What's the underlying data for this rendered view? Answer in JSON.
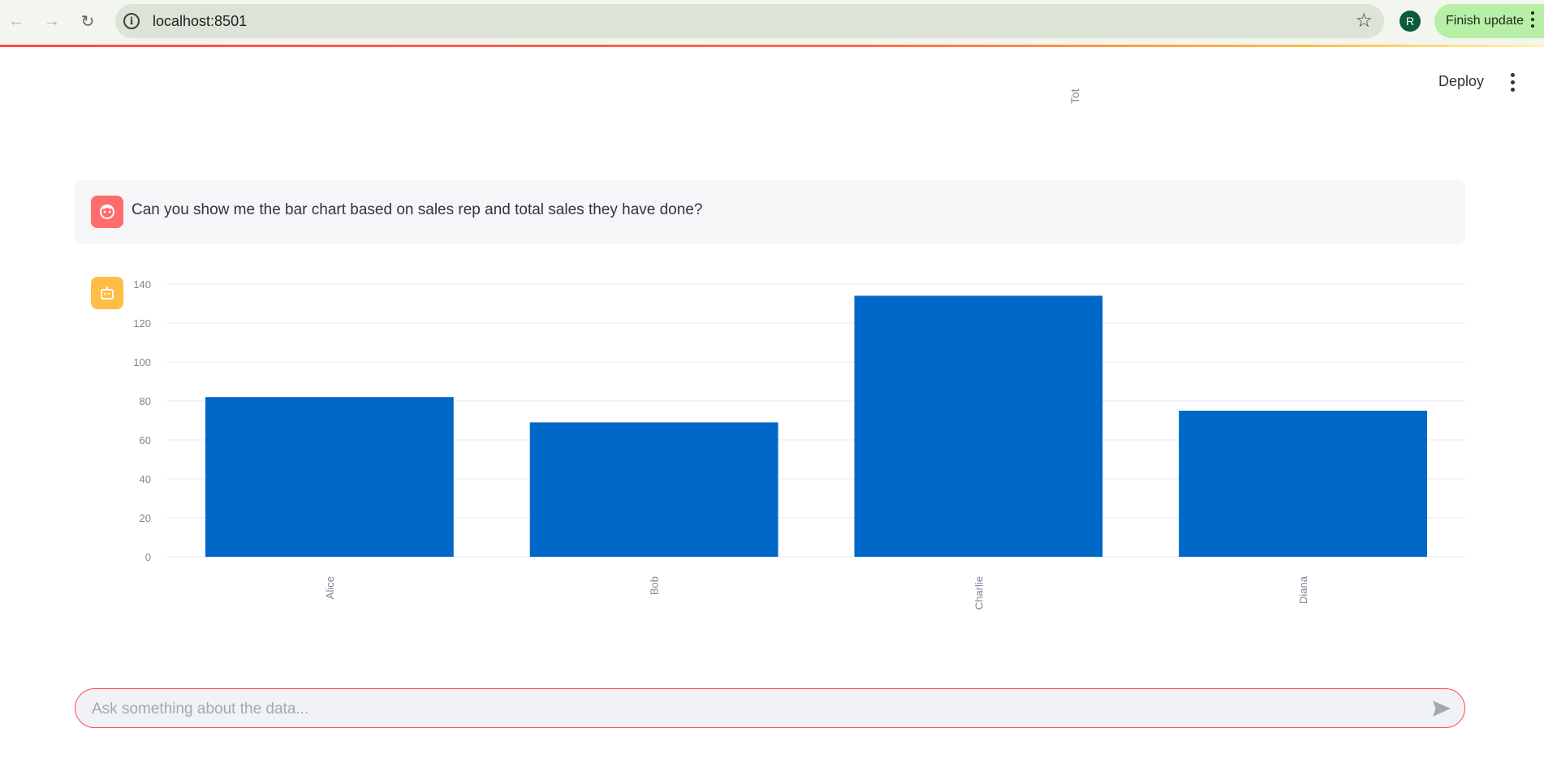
{
  "browser": {
    "url": "localhost:8501",
    "profile_initial": "R",
    "finish_update_label": "Finish update"
  },
  "header": {
    "deploy_label": "Deploy",
    "stray_axis_fragment": "Tot"
  },
  "messages": [
    {
      "role": "user",
      "text": "Can you show me the bar chart based on sales rep and total sales they have done?"
    },
    {
      "role": "assistant",
      "content": "chart"
    }
  ],
  "chart_data": {
    "type": "bar",
    "categories": [
      "Alice",
      "Bob",
      "Charlie",
      "Diana"
    ],
    "values": [
      82,
      69,
      134,
      75
    ],
    "yticks": [
      0,
      20,
      40,
      60,
      80,
      100,
      120,
      140
    ],
    "ylim": [
      0,
      140
    ],
    "title": "",
    "xlabel": "",
    "ylabel": "",
    "bar_color": "#0068c9",
    "grid": true
  },
  "chat_input": {
    "placeholder": "Ask something about the data..."
  },
  "colors": {
    "accent": "#ff4b4b",
    "user_avatar": "#ff6c6c",
    "bot_avatar": "#ffbd45"
  }
}
